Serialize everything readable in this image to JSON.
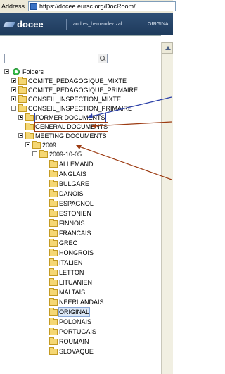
{
  "address_bar": {
    "label": "Address",
    "url": "https://docee.eursc.org/DocRoom/"
  },
  "header": {
    "logo": "docee",
    "user": "andres_hernandez.zal",
    "link": "ORIGINAL"
  },
  "search": {
    "placeholder": ""
  },
  "tree": {
    "root": "Folders",
    "items": [
      {
        "label": "COMITE_PEDAGOGIQUE_MIXTE",
        "expander": "plus"
      },
      {
        "label": "COMITE_PEDAGOGIQUE_PRIMAIRE",
        "expander": "plus"
      },
      {
        "label": "CONSEIL_INSPECTION_MIXTE",
        "expander": "plus"
      },
      {
        "label": "CONSEIL_INSPECTION_PRIMAIRE",
        "expander": "minus"
      },
      {
        "label": "FORMER DOCUMENTS",
        "expander": "plus"
      },
      {
        "label": "GENERAL DOCUMENTS",
        "expander": "none"
      },
      {
        "label": "MEETING DOCUMENTS",
        "expander": "minus"
      },
      {
        "label": "2009",
        "expander": "minus"
      },
      {
        "label": "2009-10-05",
        "expander": "minus"
      },
      {
        "label": "ALLEMAND"
      },
      {
        "label": "ANGLAIS"
      },
      {
        "label": "BULGARE"
      },
      {
        "label": "DANOIS"
      },
      {
        "label": "ESPAGNOL"
      },
      {
        "label": "ESTONIEN"
      },
      {
        "label": "FINNOIS"
      },
      {
        "label": "FRANCAIS"
      },
      {
        "label": "GREC"
      },
      {
        "label": "HONGROIS"
      },
      {
        "label": "ITALIEN"
      },
      {
        "label": "LETTON"
      },
      {
        "label": "LITUANIEN"
      },
      {
        "label": "MALTAIS"
      },
      {
        "label": "NEERLANDAIS"
      },
      {
        "label": "ORIGINAL"
      },
      {
        "label": "POLONAIS"
      },
      {
        "label": "PORTUGAIS"
      },
      {
        "label": "ROUMAIN"
      },
      {
        "label": "SLOVAQUE"
      }
    ]
  },
  "colors": {
    "highlight_blue": "#2a3fa8",
    "highlight_brown": "#9c3b12",
    "folder": "#f5d774",
    "header_bg": "#1e3a5c"
  }
}
